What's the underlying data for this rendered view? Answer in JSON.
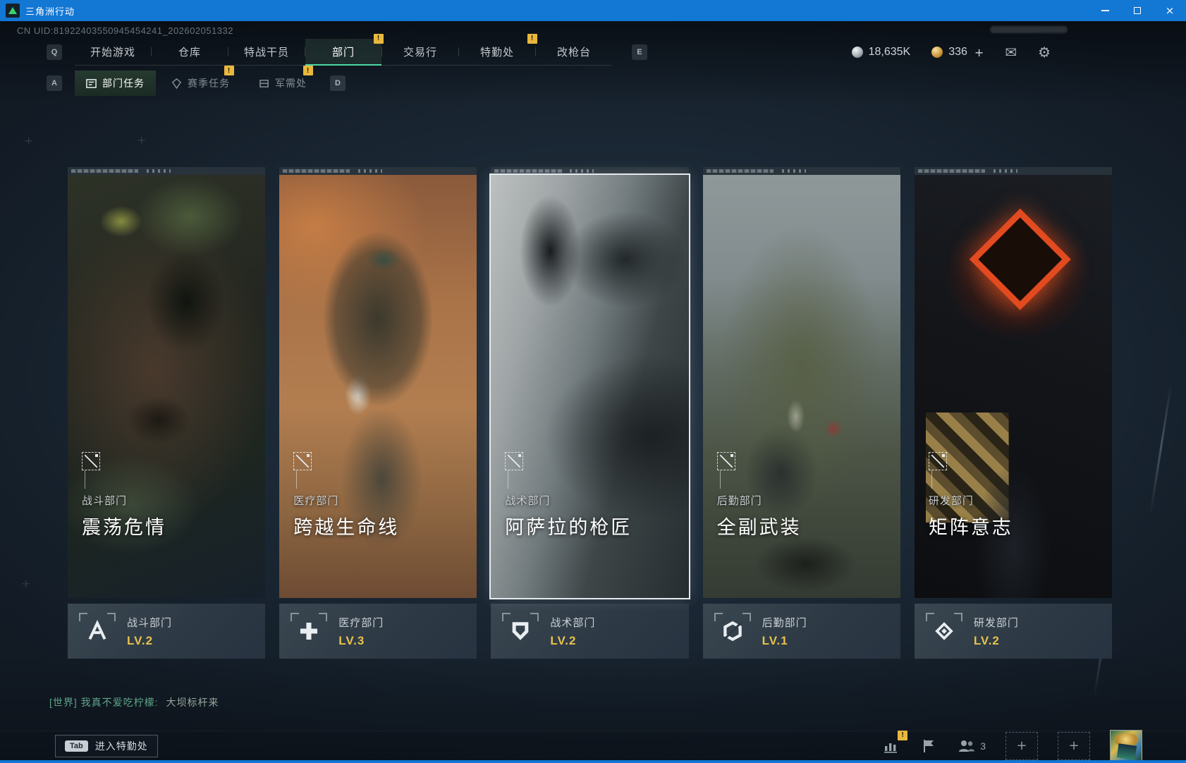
{
  "window": {
    "title": "三角洲行动"
  },
  "icons": {
    "close": "×",
    "mail": "✉",
    "gear": "⚙",
    "plus": "+",
    "alert": "!"
  },
  "uid": "CN UID:81922403550945454241_202602051332",
  "nav": {
    "key_left": "Q",
    "key_right": "E",
    "tabs": [
      {
        "label": "开始游戏"
      },
      {
        "label": "仓库"
      },
      {
        "label": "特战干员"
      },
      {
        "label": "部门"
      },
      {
        "label": "交易行"
      },
      {
        "label": "特勤处"
      },
      {
        "label": "改枪台"
      }
    ],
    "currencies": [
      {
        "name": "silver",
        "value": "18,635K"
      },
      {
        "name": "gold",
        "value": "336"
      }
    ]
  },
  "subnav": {
    "key_left": "A",
    "key_right": "D",
    "tabs": [
      {
        "label": "部门任务"
      },
      {
        "label": "赛季任务"
      },
      {
        "label": "军需处"
      }
    ]
  },
  "cards": [
    {
      "department": "战斗部门",
      "title": "震荡危情",
      "level": "LV.2"
    },
    {
      "department": "医疗部门",
      "title": "跨越生命线",
      "level": "LV.3"
    },
    {
      "department": "战术部门",
      "title": "阿萨拉的枪匠",
      "level": "LV.2"
    },
    {
      "department": "后勤部门",
      "title": "全副武装",
      "level": "LV.1"
    },
    {
      "department": "研发部门",
      "title": "矩阵意志",
      "level": "LV.2"
    }
  ],
  "chat": {
    "channel": "[世界]",
    "sender": "我真不爱吃柠檬:",
    "message": "大坝标杆来"
  },
  "bottom": {
    "key": "Tab",
    "label": "进入特勤处",
    "team_count": "3"
  }
}
